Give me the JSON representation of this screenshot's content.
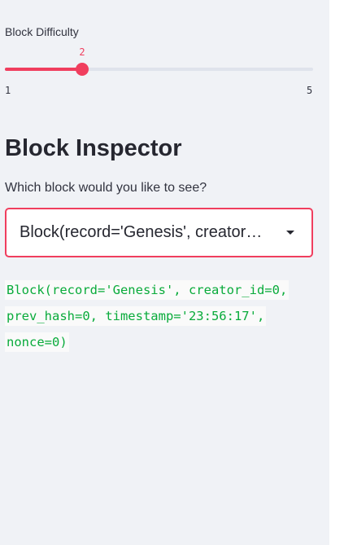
{
  "slider": {
    "label": "Block Difficulty",
    "value": "2",
    "min": "1",
    "max": "5",
    "value_num": 2,
    "min_num": 1,
    "max_num": 5,
    "accent_color": "#f03e5e"
  },
  "inspector": {
    "title": "Block Inspector",
    "prompt": "Which block would you like to see?",
    "selected": "Block(record='Genesis', creator_id=0, prev_hash=0, timestamp='23:56:17', nonce=0)",
    "output": "Block(record='Genesis', creator_id=0, prev_hash=0, timestamp='23:56:17', nonce=0)",
    "code_color": "#09ab3b"
  },
  "icons": {
    "dropdown": "chevron-down-icon"
  }
}
